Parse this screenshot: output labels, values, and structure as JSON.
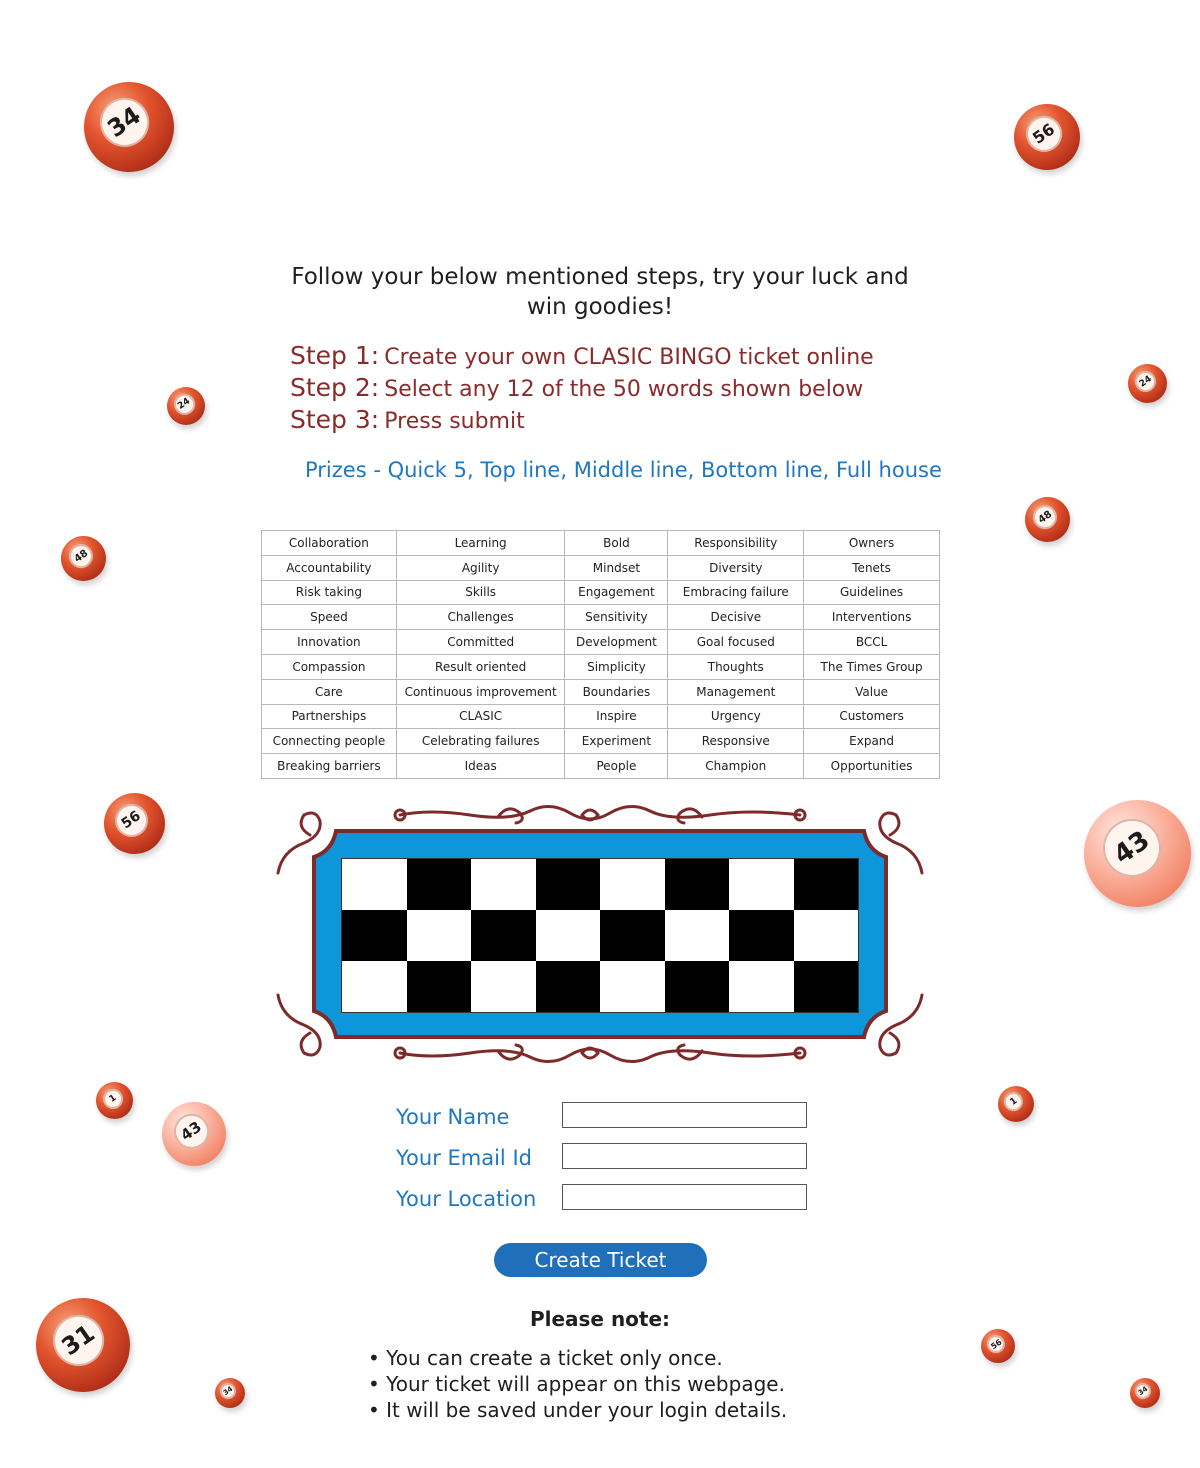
{
  "intro": {
    "line1": "Follow your below mentioned steps, try your luck and",
    "line2": "win goodies!"
  },
  "steps": [
    {
      "label": "Step 1:",
      "text": "Create your own CLASIC BINGO ticket online"
    },
    {
      "label": "Step 2:",
      "text": "Select any 12 of the 50 words shown below"
    },
    {
      "label": "Step 3:",
      "text": "Press submit"
    }
  ],
  "prizes": "Prizes - Quick 5, Top line, Middle line, Bottom line, Full house",
  "words_table": {
    "rows": [
      [
        "Collaboration",
        "Learning",
        "Bold",
        "Responsibility",
        "Owners"
      ],
      [
        "Accountability",
        "Agility",
        "Mindset",
        "Diversity",
        "Tenets"
      ],
      [
        "Risk taking",
        "Skills",
        "Engagement",
        "Embracing failure",
        "Guidelines"
      ],
      [
        "Speed",
        "Challenges",
        "Sensitivity",
        "Decisive",
        "Interventions"
      ],
      [
        "Innovation",
        "Committed",
        "Development",
        "Goal focused",
        "BCCL"
      ],
      [
        "Compassion",
        "Result oriented",
        "Simplicity",
        "Thoughts",
        "The Times Group"
      ],
      [
        "Care",
        "Continuous improvement",
        "Boundaries",
        "Management",
        "Value"
      ],
      [
        "Partnerships",
        "CLASIC",
        "Inspire",
        "Urgency",
        "Customers"
      ],
      [
        "Connecting people",
        "Celebrating failures",
        "Experiment",
        "Responsive",
        "Expand"
      ],
      [
        "Breaking barriers",
        "Ideas",
        "People",
        "Champion",
        "Opportunities"
      ]
    ]
  },
  "ticket": {
    "rows": 3,
    "cols": 8,
    "frame_color": "#0d96d9",
    "border_color": "#7e2a2a"
  },
  "form": {
    "name_label": "Your Name",
    "name_value": "",
    "email_label": "Your Email Id",
    "email_value": "",
    "location_label": "Your Location",
    "location_value": ""
  },
  "create_button": "Create Ticket",
  "note": {
    "title": "Please note:",
    "items": [
      "You can create a ticket only once.",
      "Your ticket will appear on this webpage.",
      "It will be saved under your login details."
    ]
  },
  "balls": [
    {
      "number": "34"
    },
    {
      "number": "56"
    },
    {
      "number": "24"
    },
    {
      "number": "24"
    },
    {
      "number": "48"
    },
    {
      "number": "48"
    },
    {
      "number": "56"
    },
    {
      "number": "43"
    },
    {
      "number": "1"
    },
    {
      "number": "1"
    },
    {
      "number": "43"
    },
    {
      "number": "31"
    },
    {
      "number": "34"
    },
    {
      "number": "56"
    },
    {
      "number": "34"
    }
  ],
  "colors": {
    "step": "#8a2b2b",
    "accent_blue": "#1f77c2",
    "button": "#1f6fba"
  }
}
